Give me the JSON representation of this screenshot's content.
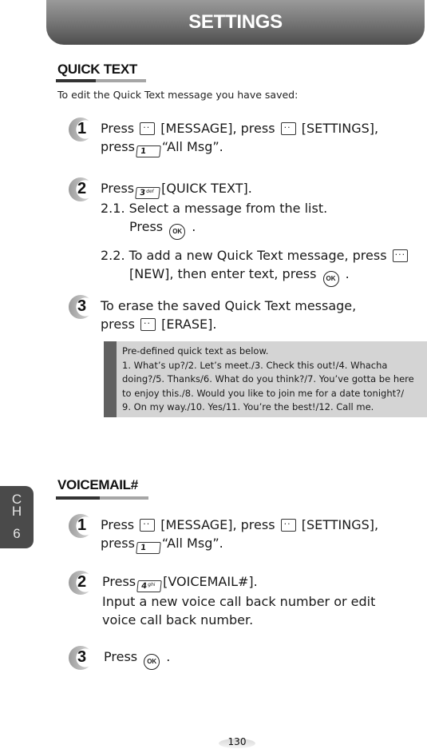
{
  "header": {
    "title": "SETTINGS"
  },
  "quick_text": {
    "title": "QUICK TEXT",
    "intro": "To edit the Quick Text message you have saved:",
    "steps": [
      {
        "number": "1",
        "line1_a": "Press",
        "line1_b": "[MESSAGE], press",
        "line1_c": "[SETTINGS],",
        "line2_a": "press",
        "line2_b": "“All Msg”."
      },
      {
        "number": "2",
        "line1_a": "Press",
        "line1_b": "[QUICK TEXT].",
        "sub1_a": "2.1. Select a message from the list.",
        "sub1_b": "Press",
        "sub1_c": ".",
        "sub2_a": "2.2. To add a new Quick Text message, press",
        "sub2_b": "[NEW], then enter text, press",
        "sub2_c": "."
      },
      {
        "number": "3",
        "line1_a": "To erase the saved Quick Text message,",
        "line2_a": "press",
        "line2_b": "[ERASE]."
      }
    ],
    "note": {
      "lines": [
        "Pre-defined quick text as below.",
        "1. What’s up?/2. Let’s meet./3. Check this out!/4. Whacha",
        "doing?/5. Thanks/6. What do you think?/7. You’ve gotta be here",
        "to enjoy this./8. Would you like to join me for a date tonight?/",
        "9. On my way./10. Yes/11. You’re the best!/12. Call me."
      ]
    }
  },
  "voicemail": {
    "title": "VOICEMAIL#",
    "steps": [
      {
        "number": "1",
        "line1_a": "Press",
        "line1_b": "[MESSAGE], press",
        "line1_c": "[SETTINGS],",
        "line2_a": "press",
        "line2_b": "“All Msg”."
      },
      {
        "number": "2",
        "line1_a": "Press",
        "line1_b": "[VOICEMAIL#].",
        "line2_a": "Input a new voice call back number or edit",
        "line3_a": "voice call back number."
      },
      {
        "number": "3",
        "line1_a": "Press",
        "line1_b": "."
      }
    ]
  },
  "keys": {
    "key1": "1",
    "key1_sub": "✉",
    "key3": "3",
    "key3_sub": "def",
    "key4": "4",
    "key4_sub": "ghi",
    "ok": "OK"
  },
  "chapter_tab": {
    "line1": "C",
    "line2": "H",
    "line3": "6"
  },
  "page_number": "130"
}
